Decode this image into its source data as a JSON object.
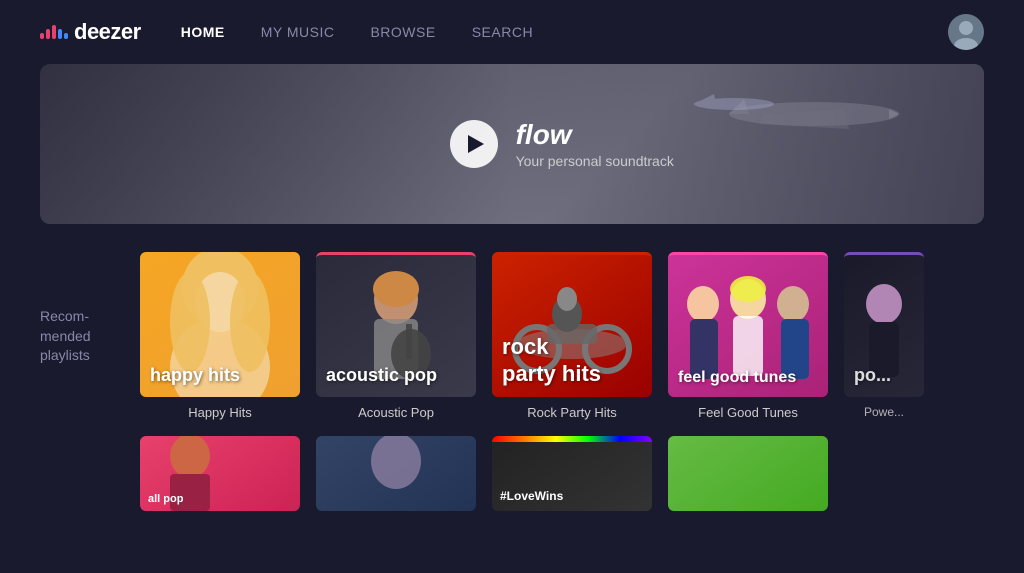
{
  "app": {
    "name": "deezer"
  },
  "nav": {
    "links": [
      {
        "id": "home",
        "label": "HOME",
        "active": true
      },
      {
        "id": "my-music",
        "label": "MY MUSIC",
        "active": false
      },
      {
        "id": "browse",
        "label": "BROWSE",
        "active": false
      },
      {
        "id": "search",
        "label": "SEARCH",
        "active": false
      }
    ]
  },
  "hero": {
    "title": "flow",
    "subtitle": "Your personal soundtrack"
  },
  "recommended": {
    "section_label": "Recom-\nmended\nplaylists",
    "playlists": [
      {
        "id": "happy-hits",
        "cover_label": "happy hits",
        "title": "Happy Hits"
      },
      {
        "id": "acoustic-pop",
        "cover_label": "acoustic pop",
        "title": "Acoustic Pop"
      },
      {
        "id": "rock-party-hits",
        "cover_label": "rock\nparty hits",
        "title": "Rock Party Hits"
      },
      {
        "id": "feel-good-tunes",
        "cover_label": "feel good tunes",
        "title": "Feel Good Tunes"
      },
      {
        "id": "power",
        "cover_label": "po...",
        "title": "Powe..."
      }
    ]
  },
  "bottom_row": {
    "items": [
      {
        "id": "all-pop",
        "cover_label": "all pop"
      },
      {
        "id": "all-pop-2",
        "cover_label": ""
      },
      {
        "id": "lovewins",
        "cover_label": "#LoveWins"
      },
      {
        "id": "green",
        "cover_label": ""
      }
    ]
  }
}
